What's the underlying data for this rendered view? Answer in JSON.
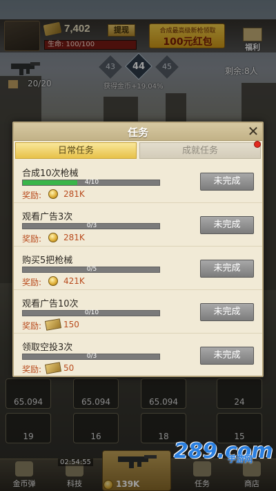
{
  "hud": {
    "cash_value": "7,402",
    "withdraw_label": "提现",
    "hp_text": "生命: 100/100",
    "promo_line1": "合成最高级新枪领取",
    "promo_line2": "100元红包",
    "welfare_label": "福利",
    "ammo_text": "20/20",
    "levels": [
      "43",
      "44",
      "45"
    ],
    "gain_text": "获得金币+19.04%",
    "remaining_text": "剩余:8人"
  },
  "dialog": {
    "title": "任务",
    "close_glyph": "✕",
    "tabs": [
      {
        "label": "日常任务",
        "active": true
      },
      {
        "label": "成就任务",
        "active": false
      }
    ],
    "reward_label": "奖励:",
    "tasks": [
      {
        "title": "合成10次枪械",
        "progress_text": "4/10",
        "progress": 0.4,
        "reward_type": "coin",
        "reward_value": "281K",
        "button_label": "未完成"
      },
      {
        "title": "观看广告3次",
        "progress_text": "0/3",
        "progress": 0,
        "reward_type": "coin",
        "reward_value": "281K",
        "button_label": "未完成"
      },
      {
        "title": "购买5把枪械",
        "progress_text": "0/5",
        "progress": 0,
        "reward_type": "coin",
        "reward_value": "421K",
        "button_label": "未完成"
      },
      {
        "title": "观看广告10次",
        "progress_text": "0/10",
        "progress": 0,
        "reward_type": "cash",
        "reward_value": "150",
        "button_label": "未完成"
      },
      {
        "title": "领取空投3次",
        "progress_text": "0/3",
        "progress": 0,
        "reward_type": "cash",
        "reward_value": "50",
        "button_label": "未完成"
      }
    ]
  },
  "grid": {
    "row1": [
      "65.094",
      "65.094",
      "65.094",
      "24"
    ],
    "row2": [
      "19",
      "16",
      "18",
      "15"
    ]
  },
  "tabbar": {
    "items": [
      "金币弹",
      "科技",
      "任务",
      "商店"
    ],
    "timer": "02:54:55",
    "center_value": "139K"
  },
  "watermark": {
    "main": "289.com",
    "sub": "手游网"
  },
  "colors": {
    "progress_fill": "#39b54a",
    "reward_text": "#b84a1c",
    "active_tab": "#e7c149",
    "button_gray": "#8c8c8c"
  }
}
